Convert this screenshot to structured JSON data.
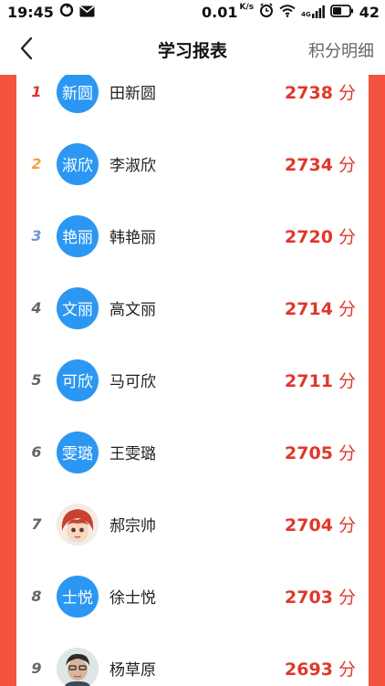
{
  "status_bar": {
    "time": "19:45",
    "net_speed": "0.01",
    "net_unit": "K/s",
    "signal_label": "4G",
    "battery": "42"
  },
  "nav": {
    "title": "学习报表",
    "right_link": "积分明细"
  },
  "ranking": [
    {
      "rank": "1",
      "avatar_text": "新圆",
      "name": "田新圆",
      "score": "2738",
      "unit": "分"
    },
    {
      "rank": "2",
      "avatar_text": "淑欣",
      "name": "李淑欣",
      "score": "2734",
      "unit": "分"
    },
    {
      "rank": "3",
      "avatar_text": "艳丽",
      "name": "韩艳丽",
      "score": "2720",
      "unit": "分"
    },
    {
      "rank": "4",
      "avatar_text": "文丽",
      "name": "高文丽",
      "score": "2714",
      "unit": "分"
    },
    {
      "rank": "5",
      "avatar_text": "可欣",
      "name": "马可欣",
      "score": "2711",
      "unit": "分"
    },
    {
      "rank": "6",
      "avatar_text": "雯璐",
      "name": "王雯璐",
      "score": "2705",
      "unit": "分"
    },
    {
      "rank": "7",
      "avatar_text": "",
      "name": "郝宗帅",
      "score": "2704",
      "unit": "分"
    },
    {
      "rank": "8",
      "avatar_text": "士悦",
      "name": "徐士悦",
      "score": "2703",
      "unit": "分"
    },
    {
      "rank": "9",
      "avatar_text": "",
      "name": "杨草原",
      "score": "2693",
      "unit": "分"
    }
  ],
  "colors": {
    "accent_red": "#f4533d",
    "score_red": "#e0372a",
    "avatar_blue": "#2b97f2",
    "rank_gold": "#f5a23a",
    "rank_blue": "#6c9bd2"
  }
}
